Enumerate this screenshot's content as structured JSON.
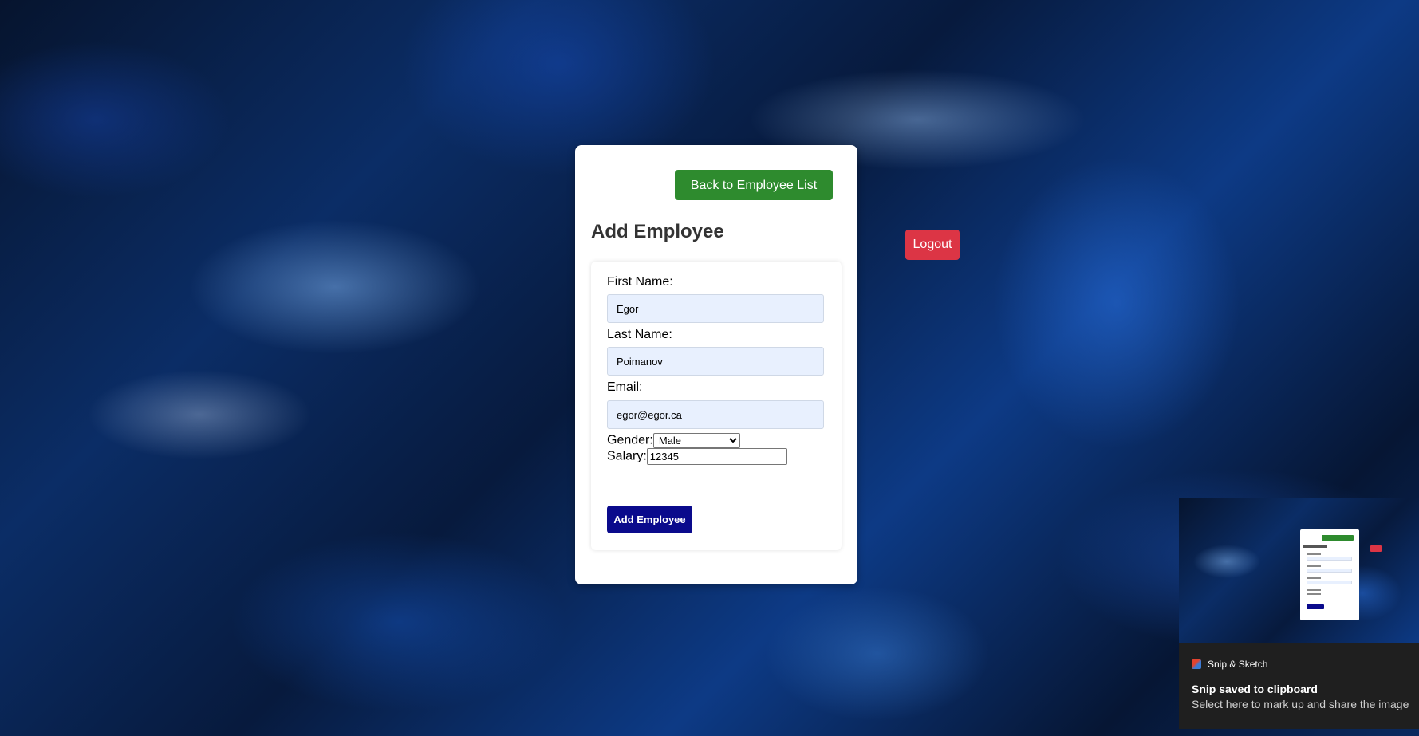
{
  "page": {
    "back_button_label": "Back to Employee List",
    "title": "Add Employee",
    "logout_label": "Logout"
  },
  "form": {
    "first_name": {
      "label": "First Name:",
      "value": "Egor"
    },
    "last_name": {
      "label": "Last Name:",
      "value": "Poimanov"
    },
    "email": {
      "label": "Email:",
      "value": "egor@egor.ca"
    },
    "gender": {
      "label": "Gender:",
      "selected": "Male"
    },
    "salary": {
      "label": "Salary:",
      "value": "12345"
    },
    "submit_label": "Add Employee"
  },
  "notification": {
    "app_name": "Snip & Sketch",
    "app_icon": "snip-sketch-icon",
    "title": "Snip saved to clipboard",
    "body": "Select here to mark up and share the image"
  },
  "colors": {
    "back_button": "#2e8b2e",
    "submit_button": "#0a0a8c",
    "logout_button": "#dc3545",
    "input_background": "#e8f0fe"
  }
}
